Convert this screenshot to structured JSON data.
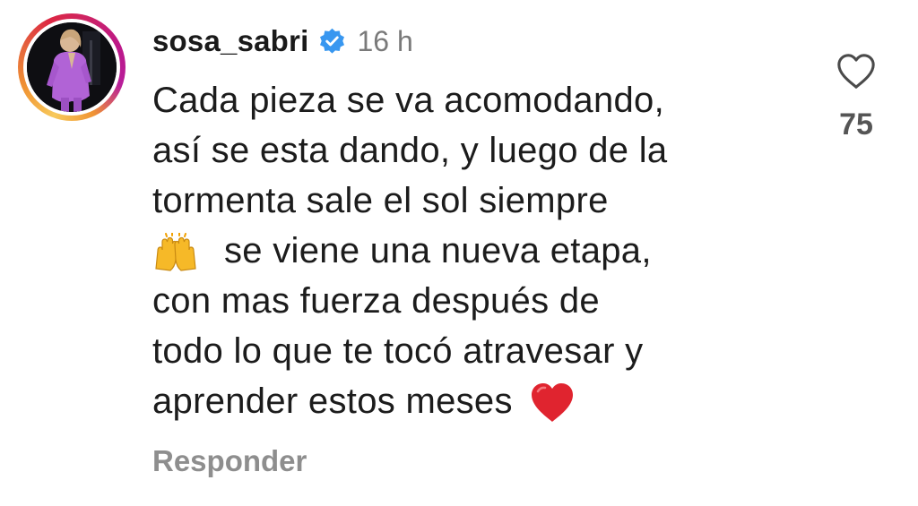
{
  "comment": {
    "username": "sosa_sabri",
    "verified": true,
    "time": "16 h",
    "lines": [
      "Cada pieza se va acomodando,",
      "así se esta dando, y luego de la",
      "tormenta sale el sol siempre",
      "se viene una nueva etapa,",
      "con mas fuerza después de",
      "todo lo que te tocó atravesar y",
      "aprender estos meses"
    ],
    "reply_label": "Responder",
    "like_count": "75",
    "icons": {
      "like": "heart-outline-icon",
      "verified": "verified-badge-icon",
      "raised_hands": "raised-hands-emoji",
      "heart_emoji": "red-heart-emoji"
    },
    "colors": {
      "verified_blue": "#3897f0",
      "muted_text": "#8e8e8e",
      "heart_red": "#e0242f"
    }
  }
}
